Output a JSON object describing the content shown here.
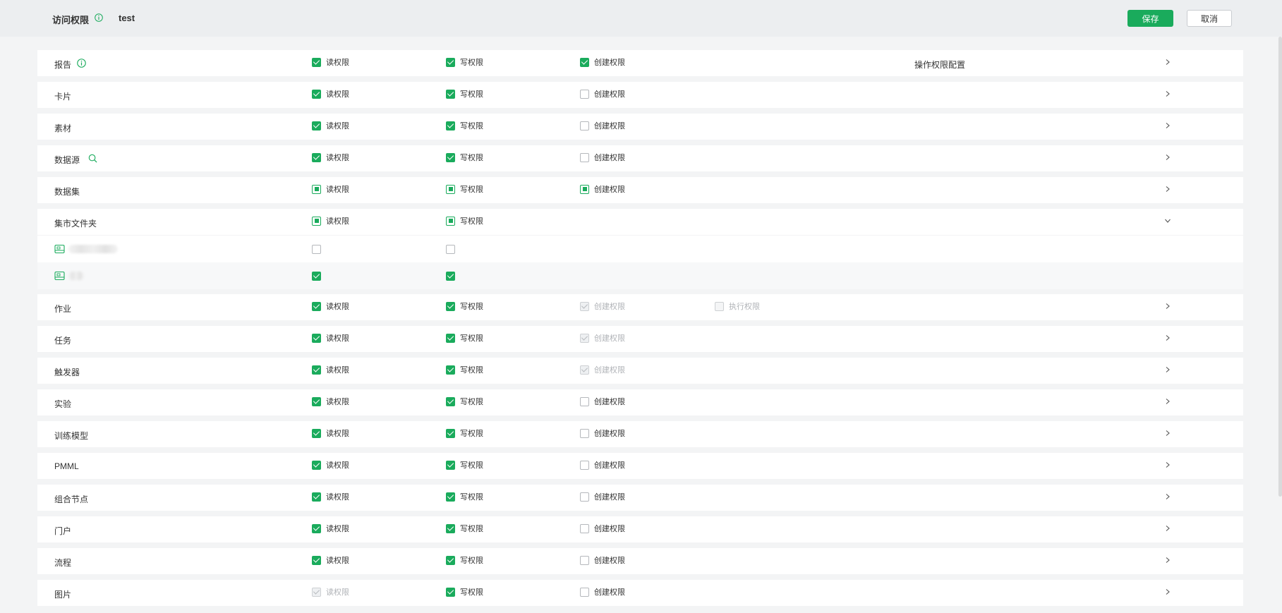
{
  "header": {
    "title": "访问权限",
    "target_name": "test",
    "save_label": "保存",
    "cancel_label": "取消"
  },
  "colors": {
    "accent": "#1aab5c",
    "header_bg": "#eceef0",
    "page_bg": "#f3f4f5"
  },
  "labels": {
    "read": "读权限",
    "write": "写权限",
    "create": "创建权限",
    "execute": "执行权限",
    "ops_config": "操作权限配置"
  },
  "rows": [
    {
      "name": "报告",
      "read": "checked",
      "write": "checked",
      "create": "checked",
      "has_info_icon": true,
      "ops_config": true,
      "chevron": "right"
    },
    {
      "name": "卡片",
      "read": "checked",
      "write": "checked",
      "create": "unchecked",
      "chevron": "right"
    },
    {
      "name": "素材",
      "read": "checked",
      "write": "checked",
      "create": "unchecked",
      "chevron": "right"
    },
    {
      "name": "数据源",
      "read": "checked",
      "write": "checked",
      "create": "unchecked",
      "has_search_icon": true,
      "chevron": "right"
    },
    {
      "name": "数据集",
      "read": "partial",
      "write": "partial",
      "create": "partial",
      "chevron": "right"
    },
    {
      "name": "集市文件夹",
      "read": "partial",
      "write": "partial",
      "chevron": "down",
      "expanded": true,
      "children": [
        {
          "icon": "folder-icon",
          "read": "unchecked",
          "write": "unchecked"
        },
        {
          "icon": "folder-icon",
          "read": "checked",
          "write": "checked"
        }
      ]
    },
    {
      "name": "作业",
      "read": "checked",
      "write": "checked",
      "create": "disabled-checked",
      "execute": "disabled-unchecked",
      "chevron": "right"
    },
    {
      "name": "任务",
      "read": "checked",
      "write": "checked",
      "create": "disabled-checked",
      "chevron": "right"
    },
    {
      "name": "触发器",
      "read": "checked",
      "write": "checked",
      "create": "disabled-checked",
      "chevron": "right"
    },
    {
      "name": "实验",
      "read": "checked",
      "write": "checked",
      "create": "unchecked",
      "chevron": "right"
    },
    {
      "name": "训练模型",
      "read": "checked",
      "write": "checked",
      "create": "unchecked",
      "chevron": "right"
    },
    {
      "name": "PMML",
      "read": "checked",
      "write": "checked",
      "create": "unchecked",
      "chevron": "right"
    },
    {
      "name": "组合节点",
      "read": "checked",
      "write": "checked",
      "create": "unchecked",
      "chevron": "right"
    },
    {
      "name": "门户",
      "read": "checked",
      "write": "checked",
      "create": "unchecked",
      "chevron": "right"
    },
    {
      "name": "流程",
      "read": "checked",
      "write": "checked",
      "create": "unchecked",
      "chevron": "right"
    },
    {
      "name": "图片",
      "read": "disabled-checked",
      "write": "checked",
      "create": "unchecked",
      "chevron": "right"
    }
  ]
}
